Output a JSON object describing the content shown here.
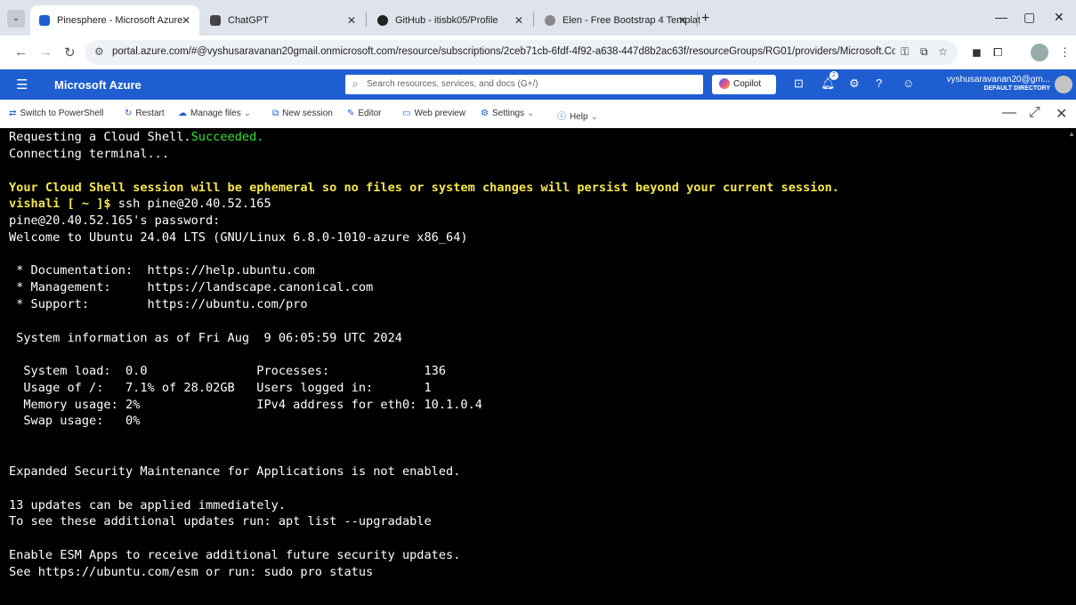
{
  "browser": {
    "tabs": [
      {
        "title": "Pinesphere - Microsoft Azure",
        "active": true,
        "color": "#1e5ed1"
      },
      {
        "title": "ChatGPT",
        "active": false,
        "color": "#444444"
      },
      {
        "title": "GitHub - itisbk05/Profile",
        "active": false,
        "color": "#222222"
      },
      {
        "title": "Elen - Free Bootstrap 4 Templat",
        "active": false,
        "color": "#888888"
      }
    ],
    "url": "portal.azure.com/#@vyshusaravanan20gmail.onmicrosoft.com/resource/subscriptions/2ceb71cb-6fdf-4f92-a638-447d8b2ac63f/resourceGroups/RG01/providers/Microsoft.Com..."
  },
  "azure": {
    "title": "Microsoft Azure",
    "search_placeholder": "Search resources, services, and docs (G+/)",
    "copilot_label": "Copilot",
    "notification_count": "2",
    "user_email": "vyshusaravanan20@gm...",
    "user_directory": "DEFAULT DIRECTORY",
    "accent": "#1e5ed1"
  },
  "cloudshell": {
    "toolbar": [
      {
        "label": "Switch to PowerShell",
        "icon": "switch-icon",
        "chevron": false
      },
      {
        "label": "Restart",
        "icon": "restart-icon",
        "chevron": false
      },
      {
        "label": "Manage files",
        "icon": "cloud-icon",
        "chevron": true
      },
      {
        "label": "New session",
        "icon": "new-session-icon",
        "chevron": false
      },
      {
        "label": "Editor",
        "icon": "pencil-icon",
        "chevron": false
      },
      {
        "label": "Web preview",
        "icon": "preview-icon",
        "chevron": false
      },
      {
        "label": "Settings",
        "icon": "gear-icon",
        "chevron": true
      },
      {
        "label": "Help",
        "icon": "help-icon",
        "chevron": true
      }
    ]
  },
  "terminal": {
    "request": "Requesting a Cloud Shell.",
    "request_status": "Succeeded.",
    "connecting": "Connecting terminal...",
    "warning": "Your Cloud Shell session will be ephemeral so no files or system changes will persist beyond your current session.",
    "prompt": "vishali [ ~ ]$",
    "command": " ssh pine@20.40.52.165",
    "password_prompt": "pine@20.40.52.165's password:",
    "welcome": "Welcome to Ubuntu 24.04 LTS (GNU/Linux 6.8.0-1010-azure x86_64)",
    "doc": " * Documentation:  https://help.ubuntu.com",
    "mgmt": " * Management:     https://landscape.canonical.com",
    "support": " * Support:        https://ubuntu.com/pro",
    "sysinfo": " System information as of Fri Aug  9 06:05:59 UTC 2024",
    "load": "  System load:  0.0               Processes:             136",
    "usage": "  Usage of /:   7.1% of 28.02GB   Users logged in:       1",
    "memory": "  Memory usage: 2%                IPv4 address for eth0: 10.1.0.4",
    "swap": "  Swap usage:   0%",
    "esm": "Expanded Security Maintenance for Applications is not enabled.",
    "updates": "13 updates can be applied immediately.",
    "updates_hint": "To see these additional updates run: apt list --upgradable",
    "esm_apps": "Enable ESM Apps to receive additional future security updates.",
    "esm_see": "See https://ubuntu.com/esm or run: sudo pro status"
  }
}
